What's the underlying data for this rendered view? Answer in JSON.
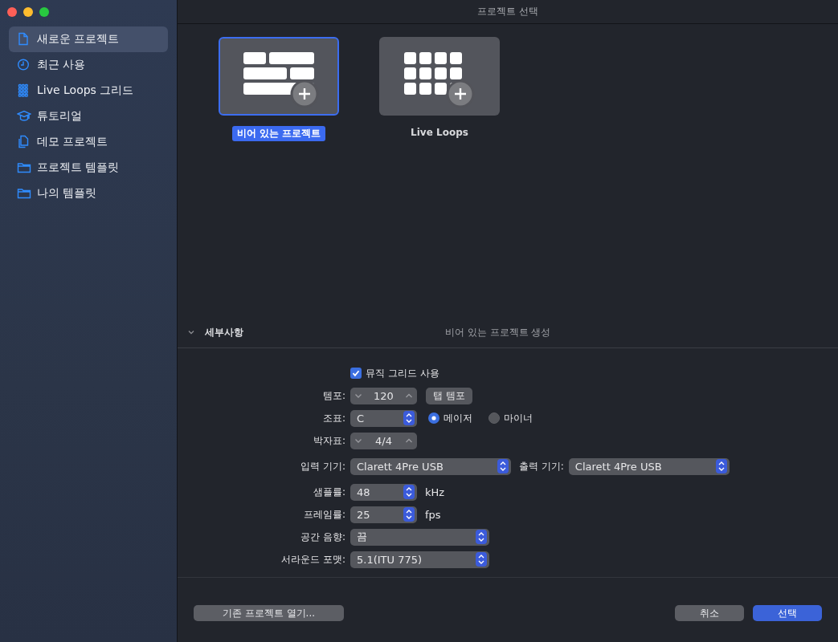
{
  "window": {
    "title": "프로젝트 선택"
  },
  "sidebar": {
    "items": [
      {
        "label": "새로운 프로젝트",
        "kind": "document",
        "selected": true
      },
      {
        "label": "최근 사용",
        "kind": "clock",
        "selected": false
      },
      {
        "label": "Live Loops 그리드",
        "kind": "grid",
        "selected": false
      },
      {
        "label": "튜토리얼",
        "kind": "cap",
        "selected": false
      },
      {
        "label": "데모 프로젝트",
        "kind": "documents",
        "selected": false
      },
      {
        "label": "프로젝트 템플릿",
        "kind": "folder",
        "selected": false
      },
      {
        "label": "나의 템플릿",
        "kind": "folder",
        "selected": false
      }
    ]
  },
  "templates": [
    {
      "label": "비어 있는 프로젝트",
      "kind": "tracks",
      "selected": true
    },
    {
      "label": "Live Loops",
      "kind": "grid",
      "selected": false
    }
  ],
  "details": {
    "label": "세부사항",
    "expanded": true,
    "summary": "비어 있는 프로젝트 생성",
    "groups": [
      [
        {
          "kind": "checkbox",
          "label": "뮤직 그리드 사용",
          "checked": true
        },
        {
          "kind": "stepper",
          "label": "템포:",
          "value": "120",
          "button": "탭 템포"
        },
        {
          "kind": "popup",
          "label": "조표:",
          "value": "C",
          "radios": [
            {
              "label": "메이저",
              "selected": true
            },
            {
              "label": "마이너",
              "selected": false
            }
          ]
        },
        {
          "kind": "stepper",
          "label": "박자표:",
          "value": "4/4"
        }
      ],
      [
        {
          "kind": "pair",
          "items": [
            {
              "label": "입력 기기:",
              "value": "Clarett 4Pre USB"
            },
            {
              "label": "출력 기기:",
              "value": "Clarett 4Pre USB"
            }
          ]
        }
      ],
      [
        {
          "kind": "popup",
          "label": "샘플률:",
          "value": "48",
          "unit": "kHz"
        },
        {
          "kind": "popup",
          "label": "프레임률:",
          "value": "25",
          "unit": "fps"
        },
        {
          "kind": "popup",
          "label": "공간 음향:",
          "value": "끔"
        },
        {
          "kind": "popup",
          "label": "서라운드 포맷:",
          "value": "5.1(ITU 775)"
        }
      ]
    ]
  },
  "footer": {
    "left_button": "기존 프로젝트 열기...",
    "buttons": [
      {
        "label": "취소",
        "default": false
      },
      {
        "label": "선택",
        "default": true
      }
    ]
  }
}
